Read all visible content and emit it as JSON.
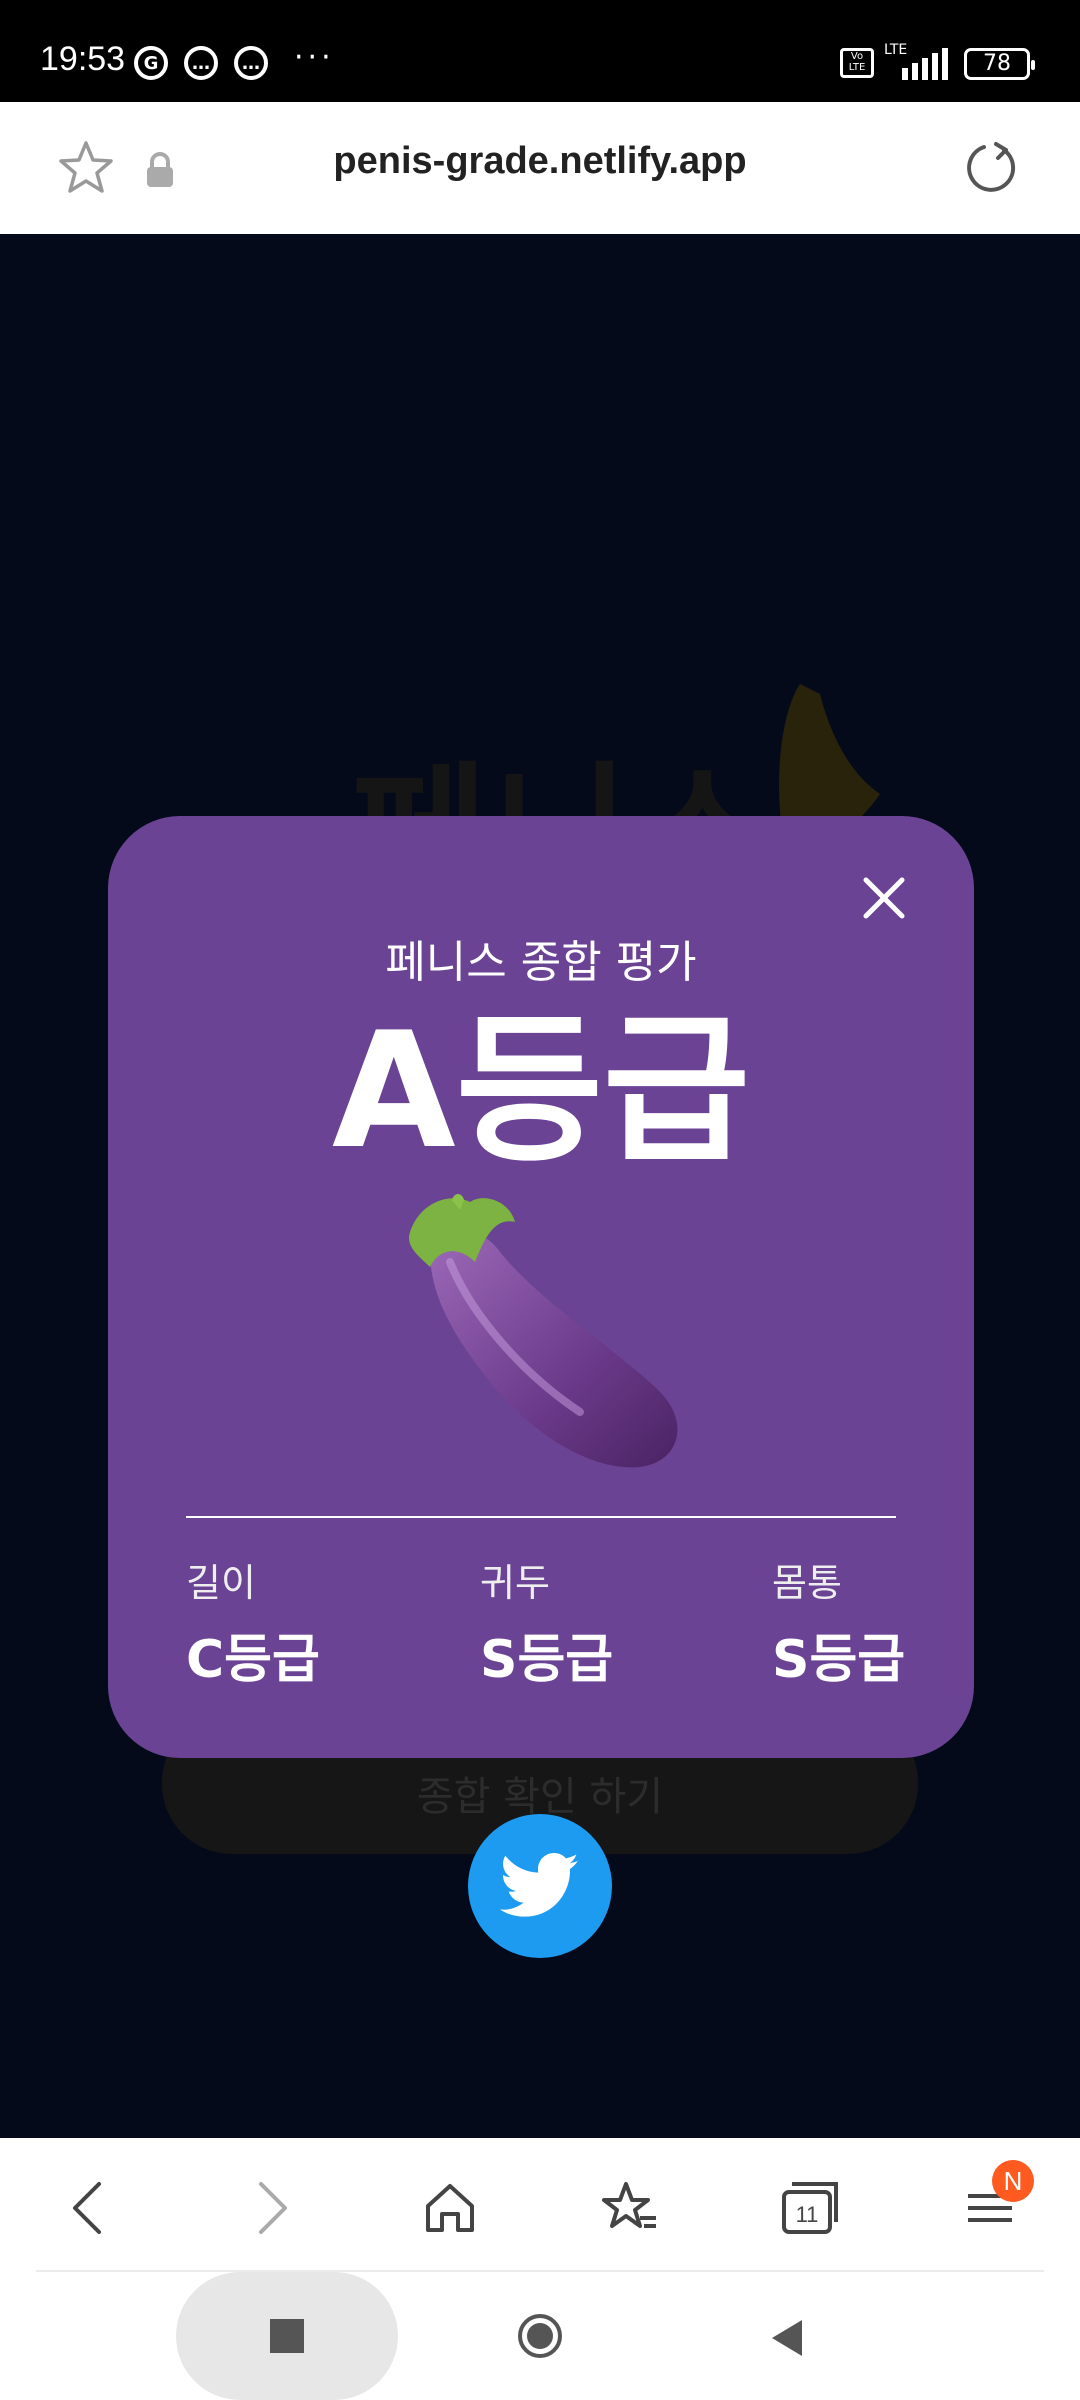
{
  "status_bar": {
    "time": "19:53",
    "notification_icons": [
      "G",
      "…",
      "…"
    ],
    "more": "···",
    "volte": "Vo LTE",
    "network": "LTE",
    "battery": "78"
  },
  "address_bar": {
    "url": "penis-grade.netlify.app",
    "icons": [
      "star-icon",
      "lock-icon",
      "reload-icon"
    ]
  },
  "background_page": {
    "title_partial": "페니스",
    "button_partial": "종합 확인 하기"
  },
  "modal": {
    "subtitle": "페니스 종합 평가",
    "grade": "A등급",
    "emoji_icon": "eggplant-icon",
    "stats": [
      {
        "label": "길이",
        "value": "C등급"
      },
      {
        "label": "귀두",
        "value": "S등급"
      },
      {
        "label": "몸통",
        "value": "S등급"
      }
    ]
  },
  "toolbar": {
    "items": [
      "back-icon",
      "forward-icon",
      "home-icon",
      "bookmarks-icon",
      "tabs-icon",
      "menu-icon"
    ],
    "tabs_count": "11",
    "menu_badge": "N"
  },
  "colors": {
    "modal_bg": "#6a4394",
    "page_bg": "#040a1a",
    "twitter_blue": "#1d9bf0",
    "badge_orange": "#ff5a1f"
  }
}
